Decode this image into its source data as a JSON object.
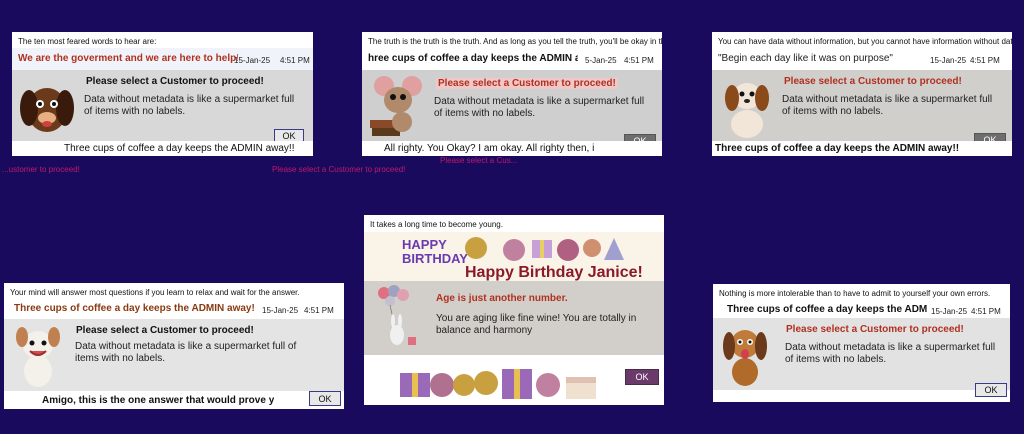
{
  "colors": {
    "background": "#1a0a5e",
    "accent_red": "#b03020",
    "accent_wine": "#8a1a2a",
    "stray_text": "#c0186a"
  },
  "stray_lines": [
    "...ustomer to proceed!",
    "Please select a Customer to proceed!",
    "Please select a Cus..."
  ],
  "dialogs": [
    {
      "quote": "The ten most feared words to hear are:",
      "headline": "We are the goverment and we are here to help!",
      "date": "15-Jan-25",
      "time": "4:51 PM",
      "title": "Please select a Customer to proceed!",
      "message": "Data without metadata is like a supermarket full of items with no labels.",
      "footer": "Three cups of coffee a day keeps the ADMIN away!!",
      "ok": "OK",
      "image": "dog-icon"
    },
    {
      "quote": "The truth is the truth is the truth. And as long as you tell the truth, you'll be okay in the end.",
      "headline": "hree cups of coffee a day keeps the ADMIN awa",
      "date": "5-Jan-25",
      "time": "4:51 PM",
      "title": "Please select a Customer to proceed!",
      "message": "Data without metadata is like a supermarket full of items with no labels.",
      "footer": "All righty. You Okay? I am okay. All righty then, it's Okay",
      "ok": "OK",
      "image": "mouse-icon"
    },
    {
      "quote": "You can have data without information, but you cannot have information without data.",
      "headline": "\"Begin each day like it was on purpose\"",
      "date": "15-Jan-25",
      "time": "4:51 PM",
      "title": "Please select a Customer to proceed!",
      "message": "Data without metadata is like a supermarket full of items with no labels.",
      "footer": "Three cups of coffee a day keeps the ADMIN away!!",
      "ok": "OK",
      "image": "puppy-icon"
    },
    {
      "quote": "It takes a long time to become young.",
      "banner_art": "HAPPY BIRTHDAY",
      "headline": "Happy Birthday Janice!",
      "title": "Age is just another number.",
      "message": "You are aging like fine wine!  You are totally in balance and harmony",
      "ok": "OK",
      "image": "bunny-balloons-icon"
    },
    {
      "quote": "Your mind will answer most questions if you learn to relax and wait for the answer.",
      "headline": "Three cups of coffee a day keeps the ADMIN away!!",
      "date": "15-Jan-25",
      "time": "4:51 PM",
      "title": "Please select a Customer to proceed!",
      "message": "Data without metadata is like a supermarket full of items with no labels.",
      "footer": "Amigo, this is the one answer that would prove you were",
      "ok": "OK",
      "image": "dog-icon"
    },
    {
      "quote": "Nothing is more intolerable than to have to admit to yourself your own errors.",
      "headline": "Three cups of coffee a day keeps the ADMIN awa",
      "date": "15-Jan-25",
      "time": "4:51 PM",
      "title": "Please select a Customer to proceed!",
      "message": "Data without metadata is like a supermarket full of items with no labels.",
      "ok": "OK",
      "image": "dog-icon"
    }
  ]
}
